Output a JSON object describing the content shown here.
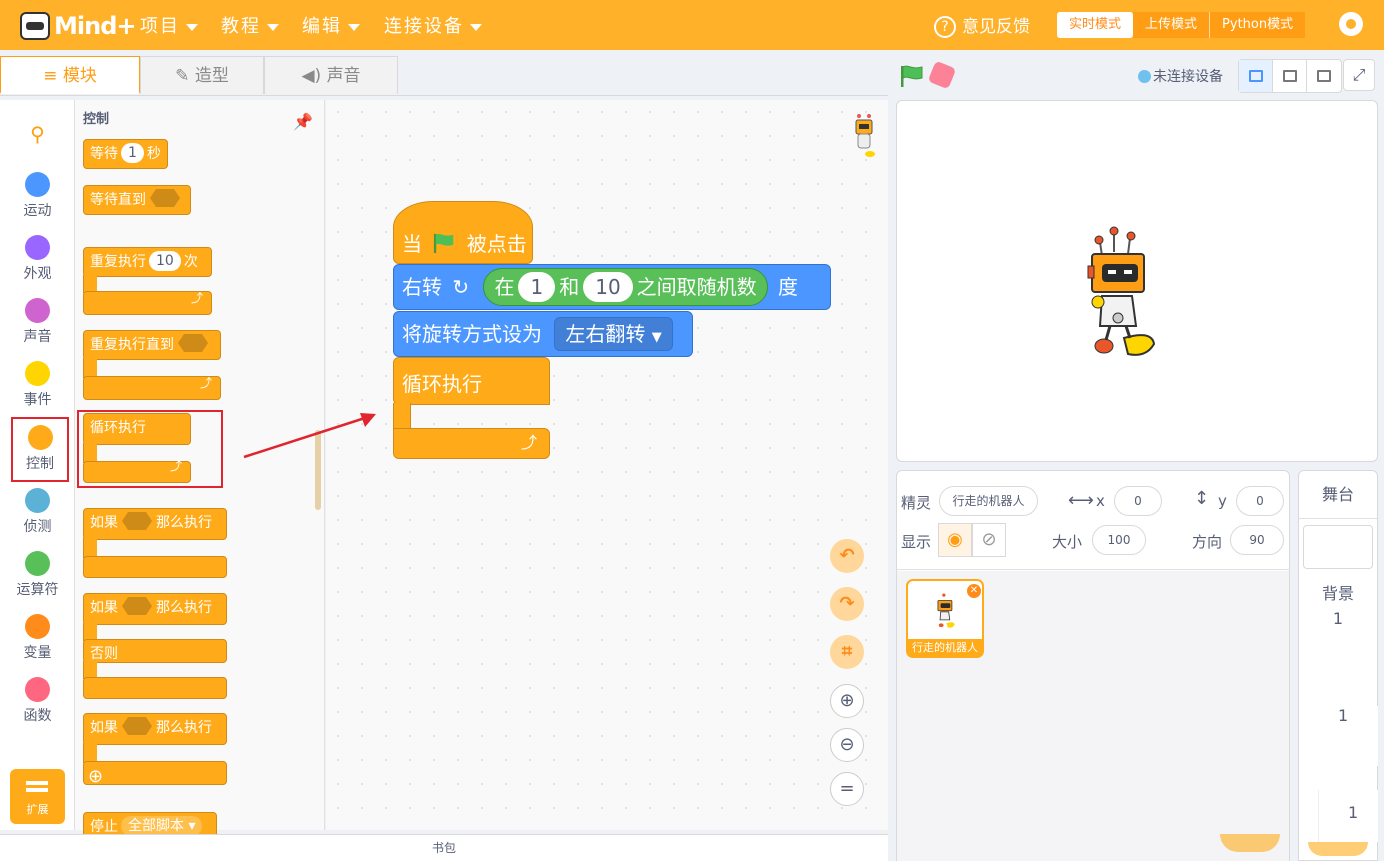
{
  "brand": {
    "name": "Mind+"
  },
  "menu": {
    "project": "项目",
    "tutorial": "教程",
    "edit": "编辑",
    "connect": "连接设备"
  },
  "header": {
    "feedback": "意见反馈",
    "modes": {
      "realtime": "实时模式",
      "upload": "上传模式",
      "python": "Python模式"
    }
  },
  "tabs": {
    "blocks": "模块",
    "costumes": "造型",
    "sounds": "声音"
  },
  "status": {
    "connection": "未连接设备"
  },
  "categories": [
    {
      "label": "运动",
      "color": "#4c97ff"
    },
    {
      "label": "外观",
      "color": "#9966ff"
    },
    {
      "label": "声音",
      "color": "#cf63cf"
    },
    {
      "label": "事件",
      "color": "#ffd500"
    },
    {
      "label": "控制",
      "color": "#ffab19"
    },
    {
      "label": "侦测",
      "color": "#5cb1d6"
    },
    {
      "label": "运算符",
      "color": "#59c059"
    },
    {
      "label": "变量",
      "color": "#ff8c1a"
    },
    {
      "label": "函数",
      "color": "#ff6680"
    }
  ],
  "extension": {
    "label": "扩展"
  },
  "palette": {
    "title": "控制",
    "wait": {
      "a": "等待",
      "val": "1",
      "b": "秒"
    },
    "wait_until": "等待直到",
    "repeat": {
      "a": "重复执行",
      "val": "10",
      "b": "次"
    },
    "repeat_until": "重复执行直到",
    "forever": "循环执行",
    "if_then": {
      "a": "如果",
      "b": "那么执行"
    },
    "else": "否则",
    "stop": {
      "a": "停止",
      "b": "全部脚本"
    }
  },
  "script": {
    "hat": {
      "a": "当",
      "b": "被点击"
    },
    "turn": {
      "a": "右转",
      "in": "在",
      "and": "和",
      "between": "之间取随机数",
      "deg": "度",
      "from": "1",
      "to": "10"
    },
    "rotation": {
      "label": "将旋转方式设为",
      "value": "左右翻转"
    },
    "forever": "循环执行"
  },
  "backpack": "书包",
  "sprite_info": {
    "sprite_label": "精灵",
    "sprite_name": "行走的机器人",
    "x_label": "x",
    "x": "0",
    "y_label": "y",
    "y": "0",
    "show_label": "显示",
    "size_label": "大小",
    "size": "100",
    "direction_label": "方向",
    "direction": "90"
  },
  "sprite_tile": {
    "name": "行走的机器人"
  },
  "stage_panel": {
    "title": "舞台",
    "backdrop_label": "背景",
    "backdrop_count": "1",
    "extra1": "1",
    "extra2": "1"
  },
  "colors": {
    "accent": "#ffb129",
    "control": "#ffab19",
    "motion": "#4c97ff",
    "operator": "#59c059",
    "highlight": "#e0252e"
  }
}
